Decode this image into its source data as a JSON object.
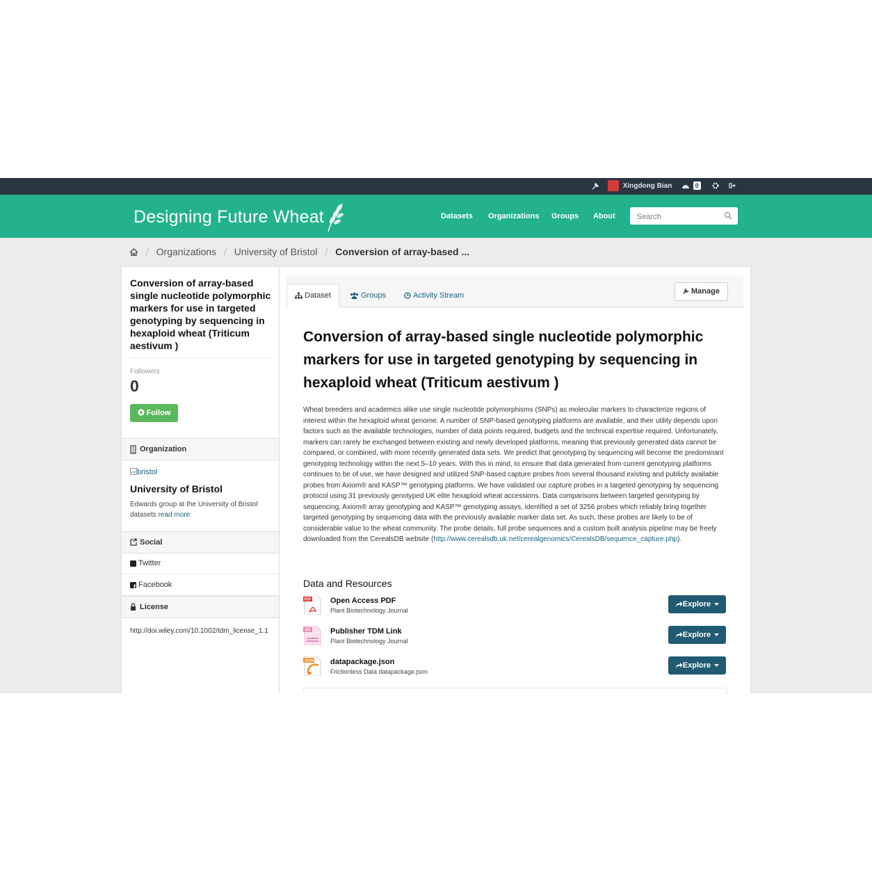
{
  "account": {
    "user_name": "Xingdong Bian",
    "dashboard_count": "0"
  },
  "site": {
    "brand": "Designing Future Wheat",
    "nav": [
      "Datasets",
      "Organizations",
      "Groups",
      "About"
    ],
    "search_placeholder": "Search"
  },
  "breadcrumb": [
    "Organizations",
    "University of Bristol",
    "Conversion of array-based ..."
  ],
  "sidebar": {
    "title": "Conversion of array-based single nucleotide polymorphic markers for use in targeted genotyping by sequencing in hexaploid wheat (Triticum aestivum )",
    "followers_label": "Followers",
    "followers_count": "0",
    "follow_label": "Follow",
    "organization_heading": "Organization",
    "org_image_alt": "bristol",
    "org_name": "University of Bristol",
    "org_description": "Edwards group at the University of Bristol datasets",
    "read_more": "read more",
    "social_heading": "Social",
    "social_links": [
      "Twitter",
      "Facebook"
    ],
    "license_heading": "License",
    "license_value": "http://doi.wiley.com/10.1002/tdm_license_1.1"
  },
  "tabs": [
    "Dataset",
    "Groups",
    "Activity Stream"
  ],
  "manage_label": "Manage",
  "dataset": {
    "title": "Conversion of array-based single nucleotide polymorphic markers for use in targeted genotyping by sequencing in hexaploid wheat (Triticum aestivum )",
    "notes": "Wheat breeders and academics alike use single nucleotide polymorphisms (SNPs) as molecular markers to characterize regions of interest within the hexaploid wheat genome. A number of SNP-based genotyping platforms are available, and their utility depends upon factors such as the available technologies, number of data points required, budgets and the technical expertise required. Unfortunately, markers can rarely be exchanged between existing and newly developed platforms, meaning that previously generated data cannot be compared, or combined, with more recently generated data sets. We predict that genotyping by sequencing will become the predominant genotyping technology within the next 5–10 years. With this in mind, to ensure that data generated from current genotyping platforms continues to be of use, we have designed and utilized SNP-based capture probes from several thousand existing and publicly available probes from Axiom® and KASP™ genotyping platforms. We have validated our capture probes in a targeted genotyping by sequencing protocol using 31 previously genotyped UK elite hexaploid wheat accessions. Data comparisons between targeted genotyping by sequencing, Axiom® array genotyping and KASP™ genotyping assays, identified a set of 3256 probes which reliably bring together targeted genotyping by sequencing data with the previously available marker data set. As such, these probes are likely to be of considerable value to the wheat community. The probe details, full probe sequences and a custom built analysis pipeline may be freely downloaded from the CerealsDB website (",
    "notes_link": "http://www.cerealsdb.uk.net/cerealgenomics/CerealsDB/sequence_capture.php",
    "notes_end": ")."
  },
  "resources": {
    "heading": "Data and Resources",
    "explore_label": "Explore",
    "items": [
      {
        "name": "Open Access PDF",
        "description": "Plant Biotechnology Journal",
        "format": "PDF",
        "color": "#e0312b"
      },
      {
        "name": "Publisher TDM Link",
        "description": "Plant Biotechnology Journal",
        "format": "API",
        "color": "#e889b6"
      },
      {
        "name": "datapackage.json",
        "description": "Frictionless Data datapackage.json",
        "format": "JSON",
        "color": "#f08c25"
      }
    ]
  },
  "colors": {
    "account_bar": "#2a3542",
    "masthead": "#23b28c",
    "explore": "#205b73",
    "follow": "#5cb85c",
    "link": "#18627d"
  }
}
